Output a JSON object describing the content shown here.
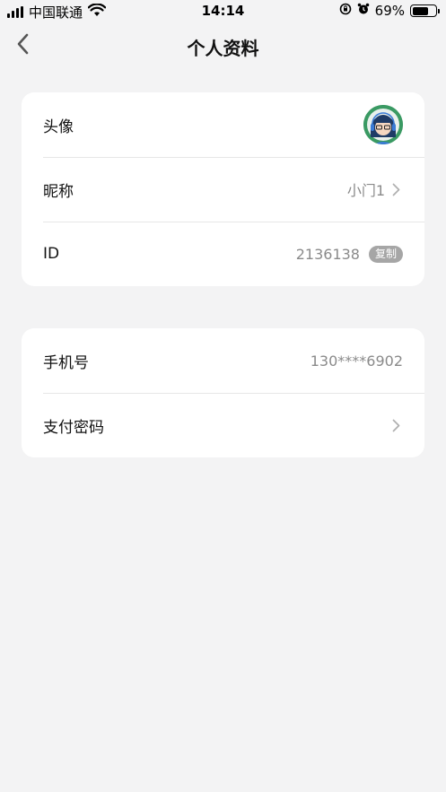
{
  "status_bar": {
    "carrier": "中国联通",
    "time": "14:14",
    "battery": "69%",
    "battery_level": 0.69
  },
  "nav": {
    "title": "个人资料",
    "back_icon": "chevron-left-icon"
  },
  "profile_card": {
    "avatar_label": "头像",
    "nickname_label": "昵称",
    "nickname_value": "小门1",
    "id_label": "ID",
    "id_value": "2136138",
    "copy_label": "复制"
  },
  "account_card": {
    "phone_label": "手机号",
    "phone_value": "130****6902",
    "pay_password_label": "支付密码"
  },
  "colors": {
    "background": "#f3f3f4",
    "card": "#ffffff",
    "secondary_text": "#8a8a8a",
    "avatar_ring": "#2e8b57"
  }
}
